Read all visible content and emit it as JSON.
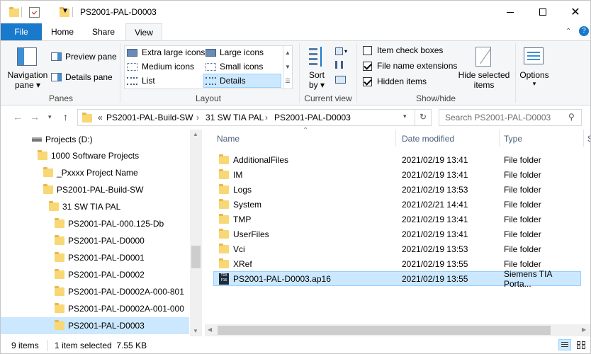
{
  "window": {
    "title": "PS2001-PAL-D0003",
    "minimize_icon": "minimize-icon",
    "maximize_icon": "maximize-icon",
    "close_icon": "close-icon"
  },
  "tabs": {
    "file": "File",
    "home": "Home",
    "share": "Share",
    "view": "View"
  },
  "ribbon": {
    "panes": {
      "label": "Panes",
      "navigation_pane_line1": "Navigation",
      "navigation_pane_line2": "pane",
      "preview_pane": "Preview pane",
      "details_pane": "Details pane"
    },
    "layout": {
      "label": "Layout",
      "extra_large_icons": "Extra large icons",
      "large_icons": "Large icons",
      "medium_icons": "Medium icons",
      "small_icons": "Small icons",
      "list": "List",
      "details": "Details"
    },
    "current_view": {
      "label": "Current view",
      "sort_by_line1": "Sort",
      "sort_by_line2": "by"
    },
    "show_hide": {
      "label": "Show/hide",
      "item_check_boxes": "Item check boxes",
      "file_name_extensions": "File name extensions",
      "hidden_items": "Hidden items",
      "hide_selected_line1": "Hide selected",
      "hide_selected_line2": "items"
    },
    "options": "Options"
  },
  "address": {
    "prefix": "«",
    "crumbs": [
      "PS2001-PAL-Build-SW",
      "31 SW TIA PAL",
      "PS2001-PAL-D0003"
    ],
    "search_placeholder": "Search PS2001-PAL-D0003"
  },
  "nav": [
    {
      "label": "Projects (D:)",
      "kind": "drive"
    },
    {
      "label": "1000 Software Projects",
      "kind": "folder"
    },
    {
      "label": "_Pxxxx Project Name",
      "kind": "folder"
    },
    {
      "label": "PS2001-PAL-Build-SW",
      "kind": "folder"
    },
    {
      "label": "31 SW TIA PAL",
      "kind": "folder"
    },
    {
      "label": "PS2001-PAL-000.125-Db",
      "kind": "folder"
    },
    {
      "label": "PS2001-PAL-D0000",
      "kind": "folder"
    },
    {
      "label": "PS2001-PAL-D0001",
      "kind": "folder"
    },
    {
      "label": "PS2001-PAL-D0002",
      "kind": "folder"
    },
    {
      "label": "PS2001-PAL-D0002A-000-801",
      "kind": "folder"
    },
    {
      "label": "PS2001-PAL-D0002A-001-000",
      "kind": "folder"
    },
    {
      "label": "PS2001-PAL-D0003",
      "kind": "folder",
      "selected": true
    }
  ],
  "columns": {
    "name": "Name",
    "date": "Date modified",
    "type": "Type",
    "size": "S"
  },
  "files": [
    {
      "name": "AdditionalFiles",
      "date": "2021/02/19 13:41",
      "type": "File folder"
    },
    {
      "name": "IM",
      "date": "2021/02/19 13:41",
      "type": "File folder"
    },
    {
      "name": "Logs",
      "date": "2021/02/19 13:53",
      "type": "File folder"
    },
    {
      "name": "System",
      "date": "2021/02/21 14:41",
      "type": "File folder"
    },
    {
      "name": "TMP",
      "date": "2021/02/19 13:41",
      "type": "File folder"
    },
    {
      "name": "UserFiles",
      "date": "2021/02/19 13:41",
      "type": "File folder"
    },
    {
      "name": "Vci",
      "date": "2021/02/19 13:53",
      "type": "File folder"
    },
    {
      "name": "XRef",
      "date": "2021/02/19 13:55",
      "type": "File folder"
    },
    {
      "name": "PS2001-PAL-D0003.ap16",
      "date": "2021/02/19 13:55",
      "type": "Siemens TIA Porta...",
      "selected": true,
      "icon": "tia-portal-file-icon",
      "icon_text": "TIA\nP16"
    }
  ],
  "status": {
    "count": "9 items",
    "selection": "1 item selected  7.55 KB"
  },
  "colors": {
    "accent": "#1979ca",
    "selection": "#cce8ff",
    "folder": "#f8d775"
  }
}
